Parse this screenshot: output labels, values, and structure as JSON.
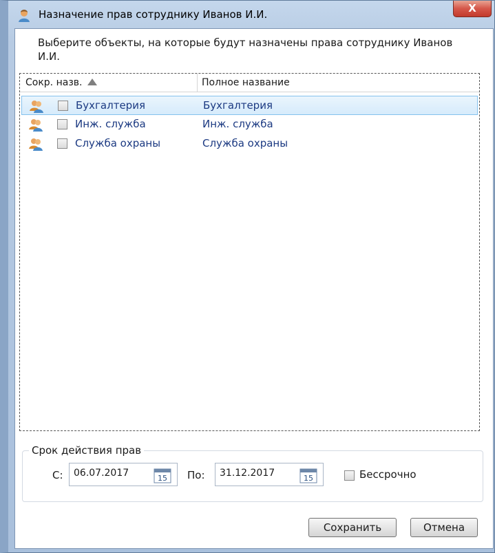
{
  "window": {
    "title": "Назначение прав сотруднику Иванов И.И.",
    "close_label": "X"
  },
  "instruction": "Выберите объекты, на которые будут назначены права сотруднику Иванов И.И.",
  "list": {
    "columns": [
      "Сокр. назв.",
      "Полное название"
    ],
    "sort_column": "Сокр. назв.",
    "sort_direction": "ascending",
    "rows": [
      {
        "short": "Бухгалтерия",
        "full": "Бухгалтерия",
        "checked": false,
        "selected": true
      },
      {
        "short": "Инж. служба",
        "full": "Инж. служба",
        "checked": false,
        "selected": false
      },
      {
        "short": "Служба охраны",
        "full": "Служба охраны",
        "checked": false,
        "selected": false
      }
    ]
  },
  "validity": {
    "group_title": "Срок действия прав",
    "from_label": "С:",
    "from_value": "06.07.2017",
    "to_label": "По:",
    "to_value": "31.12.2017",
    "calendar_day": "15",
    "unlimited_label": "Бессрочно",
    "unlimited_checked": false
  },
  "buttons": {
    "save": "Сохранить",
    "cancel": "Отмена"
  },
  "icons": {
    "title": "users-icon",
    "row": "users-group-icon",
    "calendar": "calendar-icon"
  },
  "colors": {
    "selection_bg": "#d6ebfb",
    "selection_border": "#84c1ed",
    "item_text": "#1c3a82",
    "close_button": "#c23a2c"
  }
}
